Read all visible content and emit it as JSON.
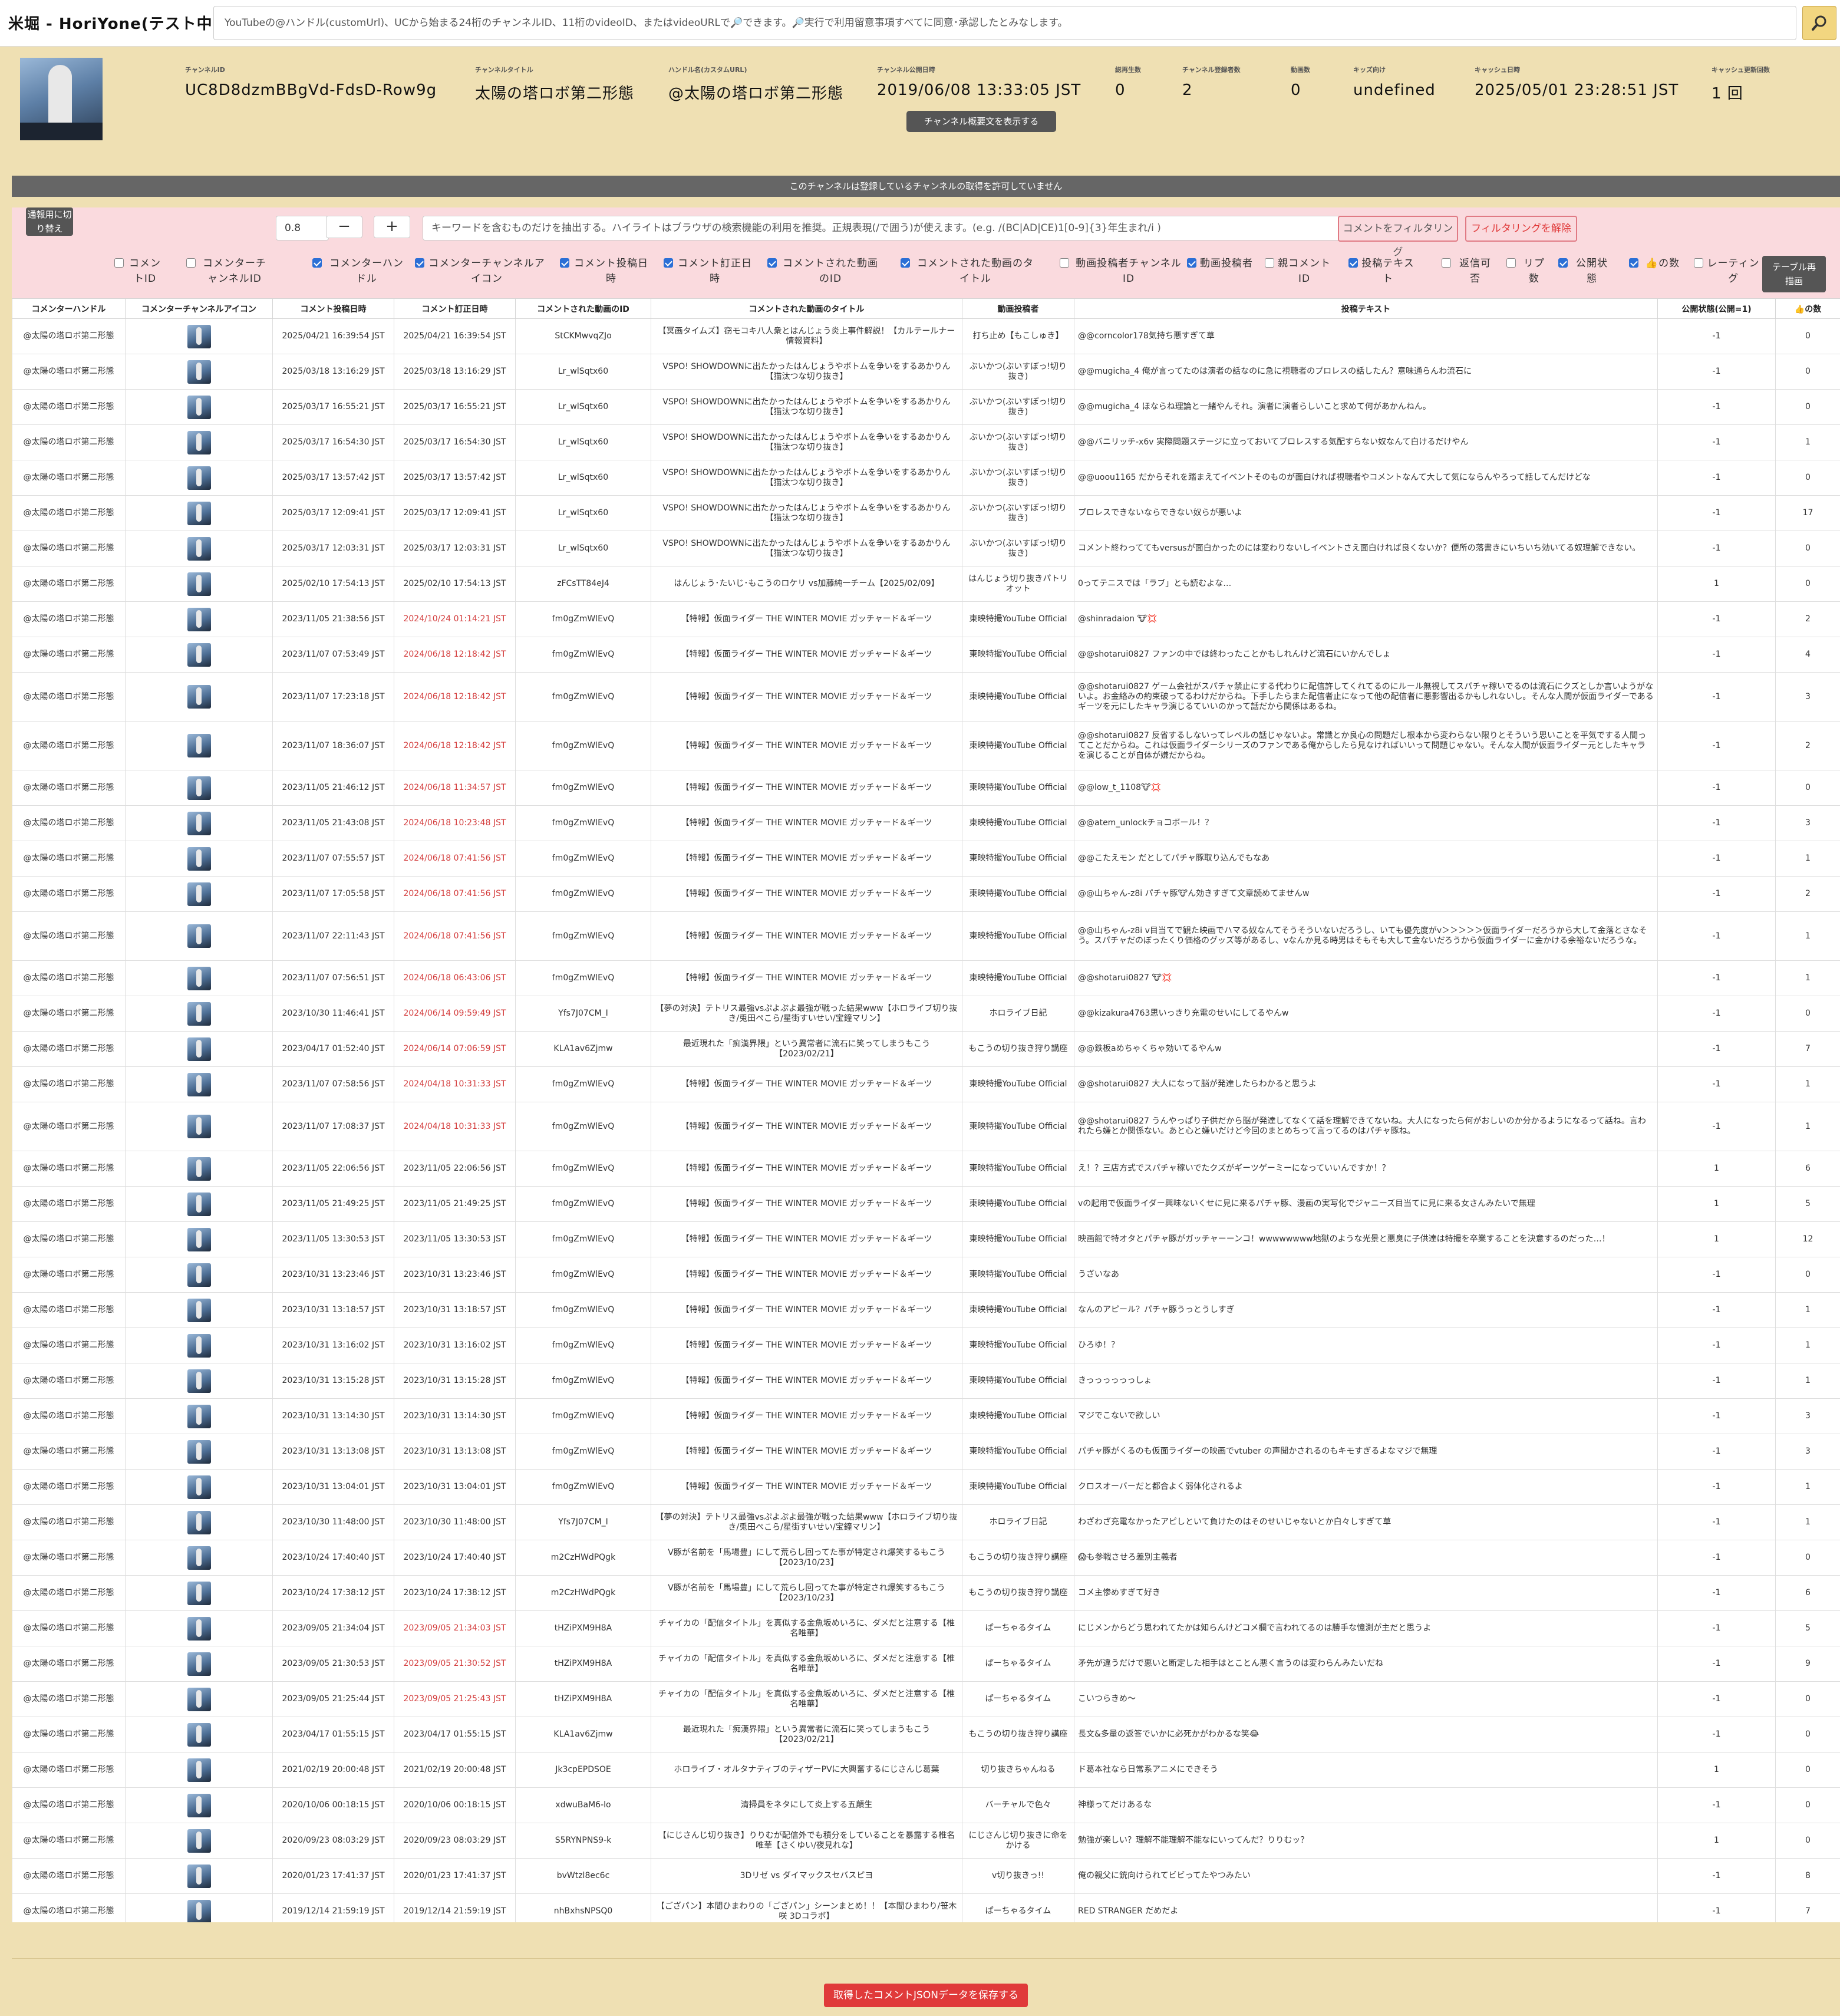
{
  "header": {
    "title": "米堀 - HoriYone(テスト中)",
    "search_placeholder": "YouTubeの@ハンドル(customUrl)、UCから始まる24桁のチャンネルID、11桁のvideoID、またはvideoURLで🔎できます。🔎実行で利用留意事項すべてに同意･承認したとみなします。"
  },
  "channel": {
    "stats": [
      {
        "label": "チャンネルID",
        "value": "UC8D8dzmBBgVd-FdsD-Row9g"
      },
      {
        "label": "チャンネルタイトル",
        "value": "太陽の塔ロボ第二形態"
      },
      {
        "label": "ハンドル名(カスタムURL)",
        "value": "@太陽の塔ロボ第二形態"
      },
      {
        "label": "チャンネル公開日時",
        "value": "2019/06/08 13:33:05 JST"
      },
      {
        "label": "総再生数",
        "value": "0"
      },
      {
        "label": "チャンネル登録者数",
        "value": "2"
      },
      {
        "label": "動画数",
        "value": "0"
      },
      {
        "label": "キッズ向け",
        "value": "undefined"
      },
      {
        "label": "キャッシュ日時",
        "value": "2025/05/01 23:28:51 JST"
      },
      {
        "label": "キャッシュ更新回数",
        "value": "1 回"
      }
    ],
    "desc_button": "チャンネル概要文を表示する"
  },
  "notice": "このチャンネルは登録しているチャンネルの取得を許可していません",
  "filter": {
    "threshold": "0.8",
    "minus": "−",
    "plus": "+",
    "keyword_placeholder": "キーワードを含むものだけを抽出する。ハイライトはブラウザの検索機能の利用を推奨。正規表現(/で囲う)が使えます。(e.g. /(BC|AD|CE)1[0-9]{3}年生まれ/i )",
    "apply": "コメントをフィルタリング",
    "clear": "フィルタリングを解除",
    "report_toggle": "通報用に切り替え",
    "redraw": "テーブル再描画",
    "columns": [
      {
        "label": "コメントID",
        "checked": false
      },
      {
        "label": "コメンターチャンネルID",
        "checked": false
      },
      {
        "label": "コメンターハンドル",
        "checked": true
      },
      {
        "label": "コメンターチャンネルアイコン",
        "checked": true
      },
      {
        "label": "コメント投稿日時",
        "checked": true
      },
      {
        "label": "コメント訂正日時",
        "checked": true
      },
      {
        "label": "コメントされた動画のID",
        "checked": true
      },
      {
        "label": "コメントされた動画のタイトル",
        "checked": true
      },
      {
        "label": "動画投稿者チャンネルID",
        "checked": false
      },
      {
        "label": "動画投稿者",
        "checked": true
      },
      {
        "label": "親コメントID",
        "checked": false
      },
      {
        "label": "投稿テキスト",
        "checked": true
      },
      {
        "label": "返信可否",
        "checked": false
      },
      {
        "label": "リプ数",
        "checked": false
      },
      {
        "label": "公開状態",
        "checked": true
      },
      {
        "label": "👍の数",
        "checked": true
      },
      {
        "label": "レーティング",
        "checked": false
      }
    ]
  },
  "table": {
    "headers": [
      "コメンターハンドル",
      "コメンターチャンネルアイコン",
      "コメント投稿日時",
      "コメント訂正日時",
      "コメントされた動画のID",
      "コメントされた動画のタイトル",
      "動画投稿者",
      "投稿テキスト",
      "公開状態(公開=1)",
      "👍の数"
    ],
    "rows": [
      [
        "@太陽の塔ロボ第二形態",
        "2025/04/21 16:39:54 JST",
        "2025/04/21 16:39:54 JST",
        "StCKMwvqZJo",
        "【冥画タイムズ】窃モコキ八人衆とはんじょう炎上事件解説！【カルテールナー情報資料】",
        "打ち止め【もこしゅき】",
        "@@corncolor178気持ち悪すぎて草",
        "-1",
        "0"
      ],
      [
        "@太陽の塔ロボ第二形態",
        "2025/03/18 13:16:29 JST",
        "2025/03/18 13:16:29 JST",
        "Lr_wlSqtx60",
        "VSPO! SHOWDOWNに出たかったはんじょうやボトムを争いをするあかりん【猫汰つな切り抜き】",
        "ぶいかつ(ぶいすぽっ!切り抜き)",
        "@@mugicha_4 俺が言ってたのは演者の話なのに急に視聴者のプロレスの話したん？意味通らんわ流石に",
        "-1",
        "0"
      ],
      [
        "@太陽の塔ロボ第二形態",
        "2025/03/17 16:55:21 JST",
        "2025/03/17 16:55:21 JST",
        "Lr_wlSqtx60",
        "VSPO! SHOWDOWNに出たかったはんじょうやボトムを争いをするあかりん【猫汰つな切り抜き】",
        "ぶいかつ(ぶいすぽっ!切り抜き)",
        "@@mugicha_4 ほならね理論と一緒やんそれ。演者に演者らしいこと求めて何があかんねん。",
        "-1",
        "0"
      ],
      [
        "@太陽の塔ロボ第二形態",
        "2025/03/17 16:54:30 JST",
        "2025/03/17 16:54:30 JST",
        "Lr_wlSqtx60",
        "VSPO! SHOWDOWNに出たかったはんじょうやボトムを争いをするあかりん【猫汰つな切り抜き】",
        "ぶいかつ(ぶいすぽっ!切り抜き)",
        "@@バニリッチ-x6v 実際問題ステージに立っておいてプロレスする気配すらない奴なんて白けるだけやん",
        "-1",
        "1"
      ],
      [
        "@太陽の塔ロボ第二形態",
        "2025/03/17 13:57:42 JST",
        "2025/03/17 13:57:42 JST",
        "Lr_wlSqtx60",
        "VSPO! SHOWDOWNに出たかったはんじょうやボトムを争いをするあかりん【猫汰つな切り抜き】",
        "ぶいかつ(ぶいすぽっ!切り抜き)",
        "@@uoou1165 だからそれを踏まえてイベントそのものが面白ければ視聴者やコメントなんて大して気にならんやろって話してんだけどな",
        "-1",
        "0"
      ],
      [
        "@太陽の塔ロボ第二形態",
        "2025/03/17 12:09:41 JST",
        "2025/03/17 12:09:41 JST",
        "Lr_wlSqtx60",
        "VSPO! SHOWDOWNに出たかったはんじょうやボトムを争いをするあかりん【猫汰つな切り抜き】",
        "ぶいかつ(ぶいすぽっ!切り抜き)",
        "プロレスできないならできない奴らが悪いよ",
        "-1",
        "17"
      ],
      [
        "@太陽の塔ロボ第二形態",
        "2025/03/17 12:03:31 JST",
        "2025/03/17 12:03:31 JST",
        "Lr_wlSqtx60",
        "VSPO! SHOWDOWNに出たかったはんじょうやボトムを争いをするあかりん【猫汰つな切り抜き】",
        "ぶいかつ(ぶいすぽっ!切り抜き)",
        "コメント終わっててもversusが面白かったのには変わりないしイベントさえ面白ければ良くないか？便所の落書きにいちいち効いてる奴理解できない。",
        "-1",
        "0"
      ],
      [
        "@太陽の塔ロボ第二形態",
        "2025/02/10 17:54:13 JST",
        "2025/02/10 17:54:13 JST",
        "zFCsTT84eJ4",
        "はんじょう･たいじ･もこうのロケリ vs加藤純一チーム【2025/02/09】",
        "はんじょう切り抜きパトリオット",
        "0ってテニスでは「ラブ」とも読むよな…",
        "1",
        "0"
      ],
      [
        "@太陽の塔ロボ第二形態",
        "2023/11/05 21:38:56 JST",
        "2024/10/24 01:14:21 JST",
        "fm0gZmWlEvQ",
        "【特報】仮面ライダー THE WINTER MOVIE ガッチャード＆ギーツ",
        "東映特撮YouTube Official",
        "@shinradaion 🐮💢",
        "-1",
        "2"
      ],
      [
        "@太陽の塔ロボ第二形態",
        "2023/11/07 07:53:49 JST",
        "2024/06/18 12:18:42 JST",
        "fm0gZmWlEvQ",
        "【特報】仮面ライダー THE WINTER MOVIE ガッチャード＆ギーツ",
        "東映特撮YouTube Official",
        "@@shotarui0827 ファンの中では終わったことかもしれんけど流石にいかんでしょ",
        "-1",
        "4"
      ],
      [
        "@太陽の塔ロボ第二形態",
        "2023/11/07 17:23:18 JST",
        "2024/06/18 12:18:42 JST",
        "fm0gZmWlEvQ",
        "【特報】仮面ライダー THE WINTER MOVIE ガッチャード＆ギーツ",
        "東映特撮YouTube Official",
        "@@shotarui0827 ゲーム会社がスパチャ禁止にする代わりに配信許してくれてるのにルール無視してスパチャ稼いでるのは流石にクズとしか言いようがないよ。お金絡みの約束破ってるわけだからね。下手したらまた配信者止になって他の配信者に悪影響出るかもしれないし。そんな人間が仮面ライダーであるギーツを元にしたキャラ演じるていいのかって話だから関係はあるね。",
        "-1",
        "3"
      ],
      [
        "@太陽の塔ロボ第二形態",
        "2023/11/07 18:36:07 JST",
        "2024/06/18 12:18:42 JST",
        "fm0gZmWlEvQ",
        "【特報】仮面ライダー THE WINTER MOVIE ガッチャード＆ギーツ",
        "東映特撮YouTube Official",
        "@@shotarui0827 反省するしないってレベルの話じゃないよ。常識とか良心の問題だし根本から変わらない限りとそういう思いことを平気でする人間ってことだからね。これは仮面ライダーシリーズのファンである俺からしたら見なければいいって問題じゃない。そんな人間が仮面ライダー元としたキャラを演じることが自体が嫌だからね。",
        "-1",
        "2"
      ],
      [
        "@太陽の塔ロボ第二形態",
        "2023/11/05 21:46:12 JST",
        "2024/06/18 11:34:57 JST",
        "fm0gZmWlEvQ",
        "【特報】仮面ライダー THE WINTER MOVIE ガッチャード＆ギーツ",
        "東映特撮YouTube Official",
        "@@low_t_1108🐮💢",
        "-1",
        "0"
      ],
      [
        "@太陽の塔ロボ第二形態",
        "2023/11/05 21:43:08 JST",
        "2024/06/18 10:23:48 JST",
        "fm0gZmWlEvQ",
        "【特報】仮面ライダー THE WINTER MOVIE ガッチャード＆ギーツ",
        "東映特撮YouTube Official",
        "@@atem_unlockチョコボール！？",
        "-1",
        "3"
      ],
      [
        "@太陽の塔ロボ第二形態",
        "2023/11/07 07:55:57 JST",
        "2024/06/18 07:41:56 JST",
        "fm0gZmWlEvQ",
        "【特報】仮面ライダー THE WINTER MOVIE ガッチャード＆ギーツ",
        "東映特撮YouTube Official",
        "@@こたえモン だとしてパチャ豚取り込んでもなあ",
        "-1",
        "1"
      ],
      [
        "@太陽の塔ロボ第二形態",
        "2023/11/07 17:05:58 JST",
        "2024/06/18 07:41:56 JST",
        "fm0gZmWlEvQ",
        "【特報】仮面ライダー THE WINTER MOVIE ガッチャード＆ギーツ",
        "東映特撮YouTube Official",
        "@@山ちゃん-z8i パチャ豚🐮ん効きすぎて文章読めてませんw",
        "-1",
        "2"
      ],
      [
        "@太陽の塔ロボ第二形態",
        "2023/11/07 22:11:43 JST",
        "2024/06/18 07:41:56 JST",
        "fm0gZmWlEvQ",
        "【特報】仮面ライダー THE WINTER MOVIE ガッチャード＆ギーツ",
        "東映特撮YouTube Official",
        "@@山ちゃん-z8i v目当てで観た映画でハマる奴なんてそうそういないだろうし、いても優先度がv＞＞＞＞＞仮面ライダーだろうから大して金落とさなそう。スパチャだのぼったくり価格のグッズ等があるし、vなんか見る時男はそもそも大して金ないだろうから仮面ライダーに金かける余裕ないだろうな。",
        "-1",
        "1"
      ],
      [
        "@太陽の塔ロボ第二形態",
        "2023/11/07 07:56:51 JST",
        "2024/06/18 06:43:06 JST",
        "fm0gZmWlEvQ",
        "【特報】仮面ライダー THE WINTER MOVIE ガッチャード＆ギーツ",
        "東映特撮YouTube Official",
        "@@shotarui0827 🐮💢",
        "-1",
        "1"
      ],
      [
        "@太陽の塔ロボ第二形態",
        "2023/10/30 11:46:41 JST",
        "2024/06/14 09:59:49 JST",
        "Yfs7J07CM_I",
        "【夢の対決】テトリス最強vsぷよぷよ最強が戦った結果www【ホロライブ切り抜き/兎田ぺこら/星街すいせい/宝鐘マリン】",
        "ホロライブ日記",
        "@@kizakura4763思いっきり充電のせいにしてるやんw",
        "-1",
        "0"
      ],
      [
        "@太陽の塔ロボ第二形態",
        "2023/04/17 01:52:40 JST",
        "2024/06/14 07:06:59 JST",
        "KLA1av6Zjmw",
        "最近現れた「痴漢界隈」という異常者に流石に笑ってしまうもこう【2023/02/21】",
        "もこうの切り抜き狩り講座",
        "@@鉄板aめちゃくちゃ効いてるやんw",
        "-1",
        "7"
      ],
      [
        "@太陽の塔ロボ第二形態",
        "2023/11/07 07:58:56 JST",
        "2024/04/18 10:31:33 JST",
        "fm0gZmWlEvQ",
        "【特報】仮面ライダー THE WINTER MOVIE ガッチャード＆ギーツ",
        "東映特撮YouTube Official",
        "@@shotarui0827 大人になって脳が発達したらわかると思うよ",
        "-1",
        "1"
      ],
      [
        "@太陽の塔ロボ第二形態",
        "2023/11/07 17:08:37 JST",
        "2024/04/18 10:31:33 JST",
        "fm0gZmWlEvQ",
        "【特報】仮面ライダー THE WINTER MOVIE ガッチャード＆ギーツ",
        "東映特撮YouTube Official",
        "@@shotarui0827 うんやっぱり子供だから脳が発達してなくて話を理解できてないね。大人になったら何がおしいのか分かるようになるって話ね。言われたら嫌とか関係ない。あと心と嫌いだけど今回のまとめちって言ってるのはパチャ豚ね。",
        "-1",
        "1"
      ],
      [
        "@太陽の塔ロボ第二形態",
        "2023/11/05 22:06:56 JST",
        "2023/11/05 22:06:56 JST",
        "fm0gZmWlEvQ",
        "【特報】仮面ライダー THE WINTER MOVIE ガッチャード＆ギーツ",
        "東映特撮YouTube Official",
        "え！？三店方式でスパチャ稼いでたクズがギーツゲーミーになっていいんですか！？",
        "1",
        "6"
      ],
      [
        "@太陽の塔ロボ第二形態",
        "2023/11/05 21:49:25 JST",
        "2023/11/05 21:49:25 JST",
        "fm0gZmWlEvQ",
        "【特報】仮面ライダー THE WINTER MOVIE ガッチャード＆ギーツ",
        "東映特撮YouTube Official",
        "vの起用で仮面ライダー興味ないくせに見に来るパチャ豚、漫画の実写化でジャニーズ目当てに見に来る女さんみたいで無理",
        "1",
        "5"
      ],
      [
        "@太陽の塔ロボ第二形態",
        "2023/11/05 13:30:53 JST",
        "2023/11/05 13:30:53 JST",
        "fm0gZmWlEvQ",
        "【特報】仮面ライダー THE WINTER MOVIE ガッチャード＆ギーツ",
        "東映特撮YouTube Official",
        "映画館で特オタとパチャ豚がガッチャーーンコ！wwwwwwww地獄のような光景と悪臭に子供達は特撮を卒業することを決意するのだった…！",
        "1",
        "12"
      ],
      [
        "@太陽の塔ロボ第二形態",
        "2023/10/31 13:23:46 JST",
        "2023/10/31 13:23:46 JST",
        "fm0gZmWlEvQ",
        "【特報】仮面ライダー THE WINTER MOVIE ガッチャード＆ギーツ",
        "東映特撮YouTube Official",
        "うざいなあ",
        "-1",
        "0"
      ],
      [
        "@太陽の塔ロボ第二形態",
        "2023/10/31 13:18:57 JST",
        "2023/10/31 13:18:57 JST",
        "fm0gZmWlEvQ",
        "【特報】仮面ライダー THE WINTER MOVIE ガッチャード＆ギーツ",
        "東映特撮YouTube Official",
        "なんのアピール？パチャ豚うっとうしすぎ",
        "-1",
        "1"
      ],
      [
        "@太陽の塔ロボ第二形態",
        "2023/10/31 13:16:02 JST",
        "2023/10/31 13:16:02 JST",
        "fm0gZmWlEvQ",
        "【特報】仮面ライダー THE WINTER MOVIE ガッチャード＆ギーツ",
        "東映特撮YouTube Official",
        "ひろゆ！？",
        "-1",
        "1"
      ],
      [
        "@太陽の塔ロボ第二形態",
        "2023/10/31 13:15:28 JST",
        "2023/10/31 13:15:28 JST",
        "fm0gZmWlEvQ",
        "【特報】仮面ライダー THE WINTER MOVIE ガッチャード＆ギーツ",
        "東映特撮YouTube Official",
        "きっっっっっっしょ",
        "-1",
        "1"
      ],
      [
        "@太陽の塔ロボ第二形態",
        "2023/10/31 13:14:30 JST",
        "2023/10/31 13:14:30 JST",
        "fm0gZmWlEvQ",
        "【特報】仮面ライダー THE WINTER MOVIE ガッチャード＆ギーツ",
        "東映特撮YouTube Official",
        "マジでこないで欲しい",
        "-1",
        "3"
      ],
      [
        "@太陽の塔ロボ第二形態",
        "2023/10/31 13:13:08 JST",
        "2023/10/31 13:13:08 JST",
        "fm0gZmWlEvQ",
        "【特報】仮面ライダー THE WINTER MOVIE ガッチャード＆ギーツ",
        "東映特撮YouTube Official",
        "パチャ豚がくるのも仮面ライダーの映画でvtuber の声聞かされるのもキモすぎるよなマジで無理",
        "-1",
        "3"
      ],
      [
        "@太陽の塔ロボ第二形態",
        "2023/10/31 13:04:01 JST",
        "2023/10/31 13:04:01 JST",
        "fm0gZmWlEvQ",
        "【特報】仮面ライダー THE WINTER MOVIE ガッチャード＆ギーツ",
        "東映特撮YouTube Official",
        "クロスオーバーだと都合よく弱体化されるよ",
        "-1",
        "1"
      ],
      [
        "@太陽の塔ロボ第二形態",
        "2023/10/30 11:48:00 JST",
        "2023/10/30 11:48:00 JST",
        "Yfs7J07CM_I",
        "【夢の対決】テトリス最強vsぷよぷよ最強が戦った結果www【ホロライブ切り抜き/兎田ぺこら/星街すいせい/宝鐘マリン】",
        "ホロライブ日記",
        "わざわざ充電なかったアピしといて負けたのはそのせいじゃないとか白々しすぎて草",
        "-1",
        "1"
      ],
      [
        "@太陽の塔ロボ第二形態",
        "2023/10/24 17:40:40 JST",
        "2023/10/24 17:40:40 JST",
        "m2CzHWdPQgk",
        "V豚が名前を「馬場豊」にして荒らし回ってた事が特定され爆笑するもこう【2023/10/23】",
        "もこうの切り抜き狩り講座",
        "😱も参戦させろ差別主義者",
        "-1",
        "0"
      ],
      [
        "@太陽の塔ロボ第二形態",
        "2023/10/24 17:38:12 JST",
        "2023/10/24 17:38:12 JST",
        "m2CzHWdPQgk",
        "V豚が名前を「馬場豊」にして荒らし回ってた事が特定され爆笑するもこう【2023/10/23】",
        "もこうの切り抜き狩り講座",
        "コメ主惨めすぎて好き",
        "-1",
        "6"
      ],
      [
        "@太陽の塔ロボ第二形態",
        "2023/09/05 21:34:04 JST",
        "2023/09/05 21:34:03 JST",
        "tHZiPXM9H8A",
        "チャイカの「配信タイトル」を真似する金魚坂めいろに、ダメだと注意する【椎名唯華】",
        "ぱーちゃるタイム",
        "にじメンからどう思われてたかは知らんけどコメ欄で言われてるのは勝手な憶測が主だと思うよ",
        "-1",
        "5"
      ],
      [
        "@太陽の塔ロボ第二形態",
        "2023/09/05 21:30:53 JST",
        "2023/09/05 21:30:52 JST",
        "tHZiPXM9H8A",
        "チャイカの「配信タイトル」を真似する金魚坂めいろに、ダメだと注意する【椎名唯華】",
        "ぱーちゃるタイム",
        "矛先が違うだけで悪いと断定した相手はとことん悪く言うのは変わらんみたいだね",
        "-1",
        "9"
      ],
      [
        "@太陽の塔ロボ第二形態",
        "2023/09/05 21:25:44 JST",
        "2023/09/05 21:25:43 JST",
        "tHZiPXM9H8A",
        "チャイカの「配信タイトル」を真似する金魚坂めいろに、ダメだと注意する【椎名唯華】",
        "ぱーちゃるタイム",
        "こいつらきめ～",
        "-1",
        "0"
      ],
      [
        "@太陽の塔ロボ第二形態",
        "2023/04/17 01:55:15 JST",
        "2023/04/17 01:55:15 JST",
        "KLA1av6Zjmw",
        "最近現れた「痴漢界隈」という異常者に流石に笑ってしまうもこう【2023/02/21】",
        "もこうの切り抜き狩り講座",
        "長文&多量の返答でいかに必死かがわかるな笑😂",
        "-1",
        "0"
      ],
      [
        "@太陽の塔ロボ第二形態",
        "2021/02/19 20:00:48 JST",
        "2021/02/19 20:00:48 JST",
        "Jk3cpEPDSOE",
        "ホロライブ・オルタナティブのティザーPVに大興奮するにじさんじ葛葉",
        "切り抜きちゃんねる",
        "ド葛本社なら日常系アニメにできそう",
        "1",
        "0"
      ],
      [
        "@太陽の塔ロボ第二形態",
        "2020/10/06 00:18:15 JST",
        "2020/10/06 00:18:15 JST",
        "xdwuBaM6-lo",
        "清掃員をネタにして炎上する五顛生",
        "バーチャルで色々",
        "神様ってだけあるな",
        "-1",
        "0"
      ],
      [
        "@太陽の塔ロボ第二形態",
        "2020/09/23 08:03:29 JST",
        "2020/09/23 08:03:29 JST",
        "S5RYNPNS9-k",
        "【にじさんじ切り抜き】りりむが配信外でも積分をしていることを暴露する椎名唯華【さくゆい/夜見れな】",
        "にじさんじ切り抜きに命をかける",
        "勉強が楽しい？理解不能理解不能なにいってんだ？りりむッ？",
        "1",
        "0"
      ],
      [
        "@太陽の塔ロボ第二形態",
        "2020/01/23 17:41:37 JST",
        "2020/01/23 17:41:37 JST",
        "bvWtzl8ec6c",
        "3Dリゼ vs ダイマックスセバスピヨ",
        "v切り抜きっ!!",
        "俺の親父に銃向けられてビビってたやつみたい",
        "-1",
        "8"
      ],
      [
        "@太陽の塔ロボ第二形態",
        "2019/12/14 21:59:19 JST",
        "2019/12/14 21:59:19 JST",
        "nhBxhsNPSQ0",
        "【ござパン】本間ひまわりの「ござパン」シーンまとめ！！【本間ひまわり/笹木咲 3Dコラボ】",
        "ぱーちゃるタイム",
        "RED STRANGER だめだよ",
        "-1",
        "7"
      ]
    ]
  },
  "footer": {
    "save": "取得したコメントJSONデータを保存する"
  }
}
